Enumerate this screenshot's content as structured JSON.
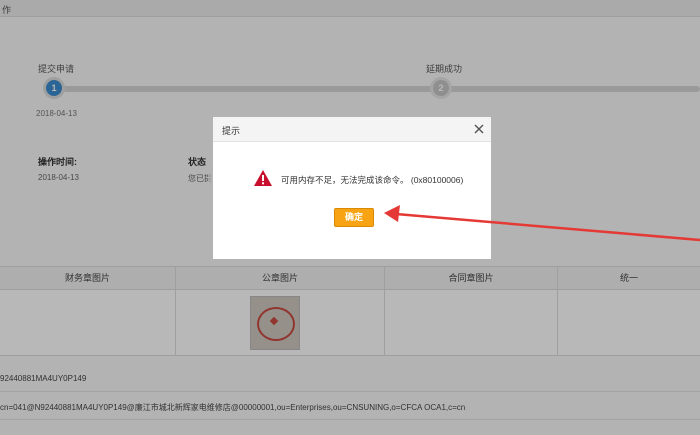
{
  "topbar": {
    "title": "作"
  },
  "progress": {
    "steps": [
      {
        "number": "1",
        "label": "提交申请",
        "date": "2018-04-13"
      },
      {
        "number": "2",
        "label": "延期成功"
      }
    ]
  },
  "info": {
    "op_time_label": "操作时间:",
    "op_time_value": "2018-04-13",
    "status_label": "状态",
    "status_value": "您已提"
  },
  "table": {
    "headers": [
      "财务章图片",
      "公章图片",
      "合同章图片",
      "统一"
    ]
  },
  "details": {
    "line1": "92440881MA4UY0P149",
    "line2": "cn=041@N92440881MA4UY0P149@廉江市城北新辉家电维修店@00000001,ou=Enterprises,ou=CNSUNING,o=CFCA OCA1,c=cn"
  },
  "dialog": {
    "title": "提示",
    "message": "可用内存不足，无法完成该命令。 (0x80100006)",
    "ok_label": "确定"
  },
  "colors": {
    "accent_blue": "#3c8dd0",
    "button_orange": "#f7a313",
    "warning_red": "#c8102e",
    "arrow_red": "#e53935"
  }
}
